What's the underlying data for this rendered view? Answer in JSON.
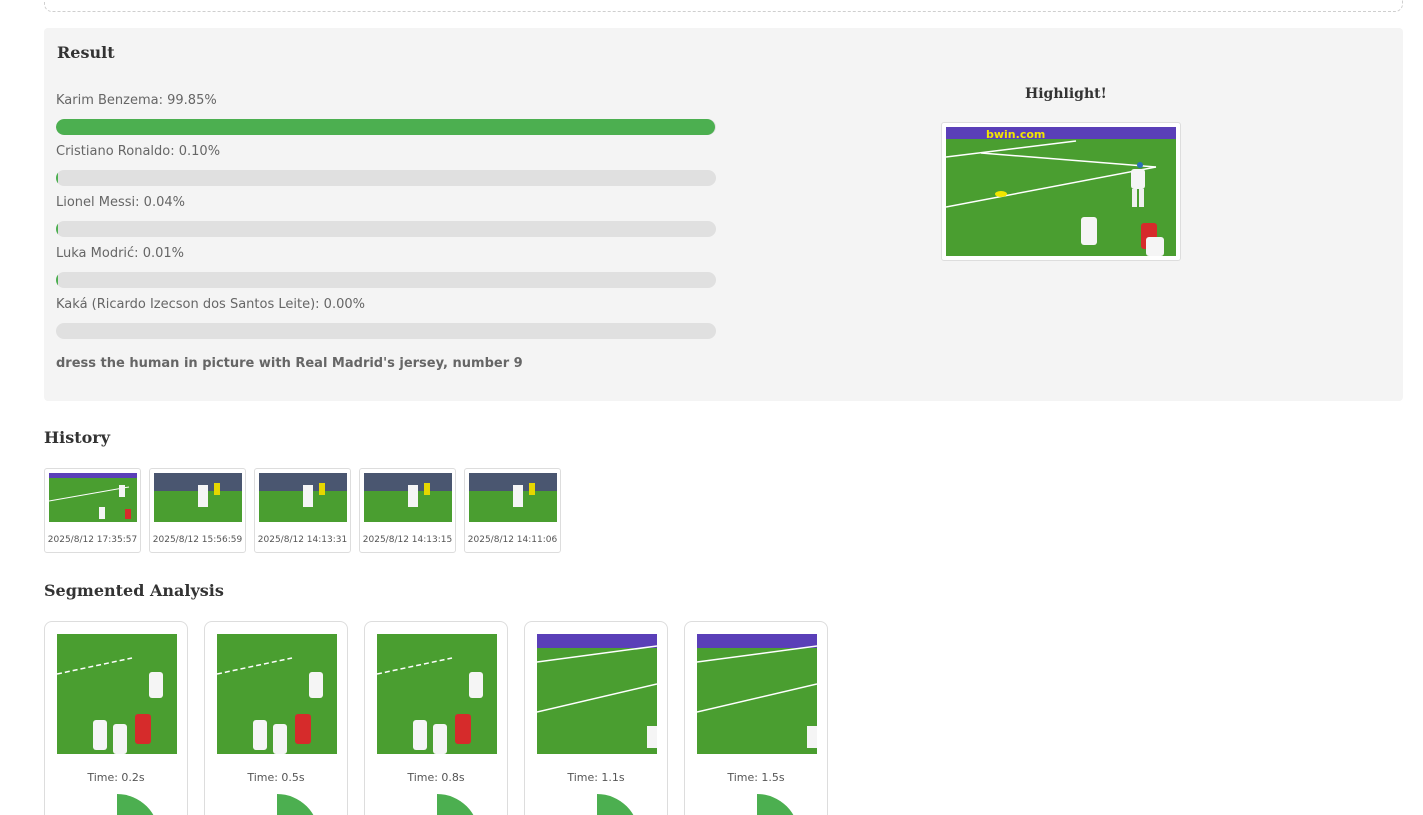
{
  "result": {
    "title": "Result",
    "predictions": [
      {
        "label": "Karim Benzema: 99.85%",
        "value": 99.85
      },
      {
        "label": "Cristiano Ronaldo: 0.10%",
        "value": 0.1
      },
      {
        "label": "Lionel Messi: 0.04%",
        "value": 0.04
      },
      {
        "label": "Luka Modrić: 0.01%",
        "value": 0.01
      },
      {
        "label": "Kaká (Ricardo Izecson dos Santos Leite): 0.00%",
        "value": 0.0
      }
    ],
    "prompt": "dress the human in picture with Real Madrid's jersey, number 9",
    "highlight_title": "Highlight!"
  },
  "history": {
    "title": "History",
    "items": [
      {
        "timestamp": "2025/8/12 17:35:57"
      },
      {
        "timestamp": "2025/8/12 15:56:59"
      },
      {
        "timestamp": "2025/8/12 14:13:31"
      },
      {
        "timestamp": "2025/8/12 14:13:15"
      },
      {
        "timestamp": "2025/8/12 14:11:06"
      }
    ]
  },
  "segmented": {
    "title": "Segmented Analysis",
    "items": [
      {
        "time": "Time: 0.2s"
      },
      {
        "time": "Time: 0.5s"
      },
      {
        "time": "Time: 0.8s"
      },
      {
        "time": "Time: 1.1s"
      },
      {
        "time": "Time: 1.5s"
      }
    ]
  },
  "colors": {
    "accent": "#4caf50",
    "track": "#e0e0e0",
    "panel": "#f4f4f4",
    "pitch": "#4a9e30"
  },
  "ad_board_text": "bwin.com"
}
